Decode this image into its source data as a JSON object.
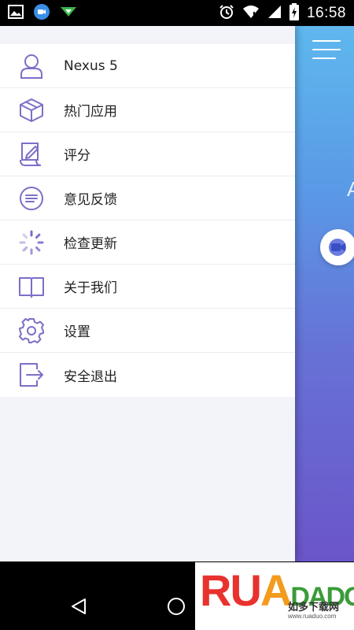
{
  "status_bar": {
    "time": "16:58",
    "left_icons": [
      "image-icon",
      "video-app-icon",
      "download-icon"
    ],
    "right_icons": [
      "alarm-icon",
      "wifi-icon",
      "signal-icon",
      "battery-charging-icon"
    ]
  },
  "drawer": {
    "items": [
      {
        "label": "Nexus 5",
        "icon": "user-icon"
      },
      {
        "label": "热门应用",
        "icon": "box-icon"
      },
      {
        "label": "评分",
        "icon": "rate-edit-icon"
      },
      {
        "label": "意见反馈",
        "icon": "feedback-chat-icon"
      },
      {
        "label": "检查更新",
        "icon": "loading-update-icon"
      },
      {
        "label": "关于我们",
        "icon": "book-icon"
      },
      {
        "label": "设置",
        "icon": "gear-icon"
      },
      {
        "label": "安全退出",
        "icon": "logout-icon"
      }
    ]
  },
  "app_peek": {
    "letter": "A"
  },
  "nav_bar": {
    "icons": [
      "back-icon",
      "home-icon"
    ]
  },
  "watermark": {
    "brand_r": "R",
    "brand_u": "U",
    "brand_a": "A",
    "brand_rest": "DADO",
    "subtitle": "如多下载网",
    "url": "www.ruaduo.com"
  },
  "colors": {
    "icon_purple": "#7b6fc8",
    "drawer_bg": "#f3f4f9",
    "peek_top": "#5fb8ee",
    "peek_bottom": "#6b55c9"
  }
}
